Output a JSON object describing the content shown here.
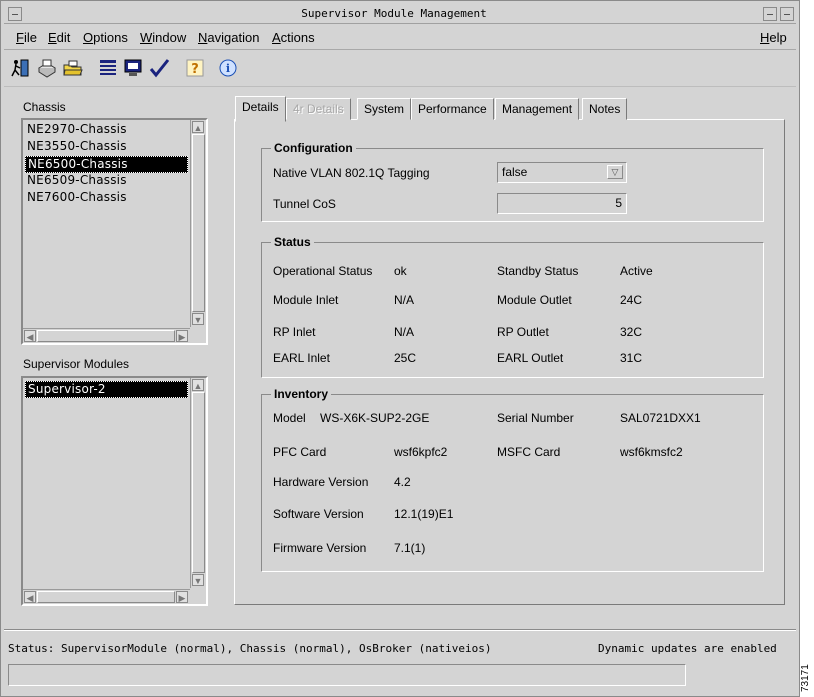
{
  "window": {
    "title": "Supervisor Module Management"
  },
  "menu": [
    {
      "label": "File",
      "u": "F",
      "rest": "ile"
    },
    {
      "label": "Edit",
      "u": "E",
      "rest": "dit"
    },
    {
      "label": "Options",
      "u": "O",
      "rest": "ptions"
    },
    {
      "label": "Window",
      "u": "W",
      "rest": "indow"
    },
    {
      "label": "Navigation",
      "u": "N",
      "rest": "avigation"
    },
    {
      "label": "Actions",
      "u": "A",
      "rest": "ctions"
    },
    {
      "label": "Help",
      "u": "H",
      "rest": "elp"
    }
  ],
  "toolbar": {
    "icons": [
      "exit-icon",
      "print-icon",
      "open-folder-icon",
      "list-icon",
      "monitor-icon",
      "checkmark-icon",
      "help-icon",
      "info-icon"
    ]
  },
  "chassis": {
    "label": "Chassis",
    "items": [
      "NE2970-Chassis",
      "NE3550-Chassis",
      "NE6500-Chassis",
      "NE6509-Chassis",
      "NE7600-Chassis"
    ],
    "selected": "NE6500-Chassis"
  },
  "supervisor": {
    "label": "Supervisor Modules",
    "items": [
      "Supervisor-2"
    ],
    "selected": "Supervisor-2"
  },
  "tabs": [
    {
      "label": "Details",
      "state": "active"
    },
    {
      "label": "4r Details",
      "state": "disabled"
    },
    {
      "label": "System",
      "state": "normal"
    },
    {
      "label": "Performance",
      "state": "normal"
    },
    {
      "label": "Management",
      "state": "normal"
    },
    {
      "label": "Notes",
      "state": "normal"
    }
  ],
  "configuration": {
    "title": "Configuration",
    "native_vlan_label": "Native VLAN 802.1Q Tagging",
    "native_vlan_value": "false",
    "tunnel_cos_label": "Tunnel CoS",
    "tunnel_cos_value": "5"
  },
  "status": {
    "title": "Status",
    "operational_status_label": "Operational Status",
    "operational_status_value": "ok",
    "standby_status_label": "Standby Status",
    "standby_status_value": "Active",
    "module_inlet_label": "Module Inlet",
    "module_inlet_value": "N/A",
    "module_outlet_label": "Module Outlet",
    "module_outlet_value": "24C",
    "rp_inlet_label": "RP Inlet",
    "rp_inlet_value": "N/A",
    "rp_outlet_label": "RP Outlet",
    "rp_outlet_value": "32C",
    "earl_inlet_label": "EARL Inlet",
    "earl_inlet_value": "25C",
    "earl_outlet_label": "EARL Outlet",
    "earl_outlet_value": "31C"
  },
  "inventory": {
    "title": "Inventory",
    "model_label": "Model",
    "model_value": "WS-X6K-SUP2-2GE",
    "serial_label": "Serial Number",
    "serial_value": "SAL0721DXX1",
    "pfc_label": "PFC Card",
    "pfc_value": "wsf6kpfc2",
    "msfc_label": "MSFC Card",
    "msfc_value": "wsf6kmsfc2",
    "hw_label": "Hardware Version",
    "hw_value": "4.2",
    "sw_label": "Software Version",
    "sw_value": "12.1(19)E1",
    "fw_label": "Firmware Version",
    "fw_value": "7.1(1)"
  },
  "statusbar": {
    "text": "Status: SupervisorModule (normal), Chassis (normal), OsBroker (nativeios)",
    "dynamic": "Dynamic updates are enabled"
  },
  "figure_id": "73171"
}
